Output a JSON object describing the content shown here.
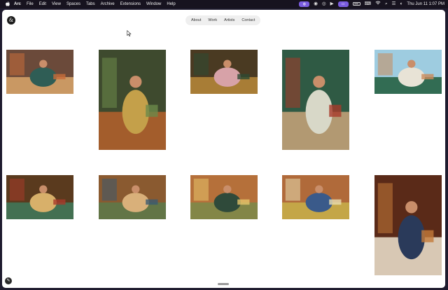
{
  "menubar": {
    "apple": "",
    "items": [
      "Arc",
      "File",
      "Edit",
      "View",
      "Spaces",
      "Tabs",
      "Archive",
      "Extensions",
      "Window",
      "Help"
    ],
    "clock": "Thu Jun 11  1:07 PM"
  },
  "site": {
    "logo_glyph": "&",
    "nav": [
      "About",
      "Work",
      "Artists",
      "Contact"
    ]
  },
  "photos": [
    {
      "name": "woman-sofa-laptop",
      "palette": [
        "#6b4a3a",
        "#d9a66b",
        "#2f5d55",
        "#c86d3a"
      ]
    },
    {
      "name": "woman-orange-chair",
      "palette": [
        "#3e4a2e",
        "#b5602c",
        "#c4a04a",
        "#6b8a4a"
      ]
    },
    {
      "name": "woman-reading-chair",
      "palette": [
        "#4a3a22",
        "#b98a3a",
        "#d7a2a8",
        "#2d4a33"
      ]
    },
    {
      "name": "man-green-sofa",
      "palette": [
        "#2f5a44",
        "#c9a47a",
        "#d8d8c8",
        "#a83a2a"
      ]
    },
    {
      "name": "man-phone-portrait",
      "palette": [
        "#9ecce0",
        "#1f5a3a",
        "#e8e3d6",
        "#c98a5a"
      ]
    },
    {
      "name": "group-laptops-table",
      "palette": [
        "#5a3a1e",
        "#3f7a5c",
        "#d8b06a",
        "#a83a2a"
      ]
    },
    {
      "name": "wooden-desk-room",
      "palette": [
        "#8a5a30",
        "#5a7a4a",
        "#d9b07a",
        "#3a5a70"
      ]
    },
    {
      "name": "women-overhead-chairs",
      "palette": [
        "#b5703a",
        "#7a8a4a",
        "#2f4a3a",
        "#e6c46a"
      ]
    },
    {
      "name": "woman-wooden-chair",
      "palette": [
        "#b06a3a",
        "#c8b04a",
        "#3a5a8a",
        "#e8ddb0"
      ]
    },
    {
      "name": "woman-cream-blouse-phone",
      "palette": [
        "#5a2a18",
        "#efe4d0",
        "#2a3a5a",
        "#c47a3a"
      ]
    }
  ]
}
